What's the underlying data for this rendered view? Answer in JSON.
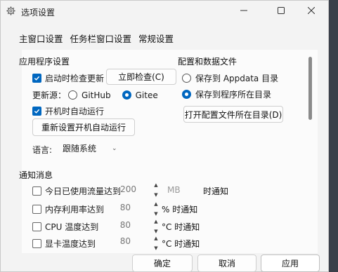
{
  "window": {
    "title": "选项设置"
  },
  "tabs": [
    "主窗口设置",
    "任务栏窗口设置",
    "常规设置"
  ],
  "app_settings": {
    "heading": "应用程序设置",
    "check_update_label": "启动时检查更新",
    "check_update_checked": true,
    "check_now_button": "立即检查(C)",
    "update_source_label": "更新源：",
    "sources": [
      "GitHub",
      "Gitee"
    ],
    "selected_source": "Gitee",
    "autostart_label": "开机时自动运行",
    "autostart_checked": true,
    "reset_autostart_button": "重新设置开机自动运行",
    "language_label": "语言:",
    "language_value": "跟随系统"
  },
  "config": {
    "heading": "配置和数据文件",
    "options": [
      "保存到 Appdata 目录",
      "保存到程序所在目录"
    ],
    "selected": "保存到程序所在目录",
    "open_dir_button": "打开配置文件所在目录(D)"
  },
  "notifications": {
    "heading": "通知消息",
    "items": [
      {
        "label": "今日已使用流量达到",
        "value": "200",
        "unit": "MB",
        "suffix": "时通知",
        "checked": false
      },
      {
        "label": "内存利用率达到",
        "value": "80",
        "unit": "% 时通知",
        "checked": false
      },
      {
        "label": "CPU 温度达到",
        "value": "80",
        "unit": "°C 时通知",
        "checked": false
      },
      {
        "label": "显卡温度达到",
        "value": "80",
        "unit": "°C 时通知",
        "checked": false
      }
    ]
  },
  "footer": {
    "ok": "确定",
    "cancel": "取消",
    "apply": "应用"
  },
  "colors": {
    "accent": "#0067c0",
    "window_bg": "#f3f3f3",
    "desktop": "#3a3f49"
  }
}
